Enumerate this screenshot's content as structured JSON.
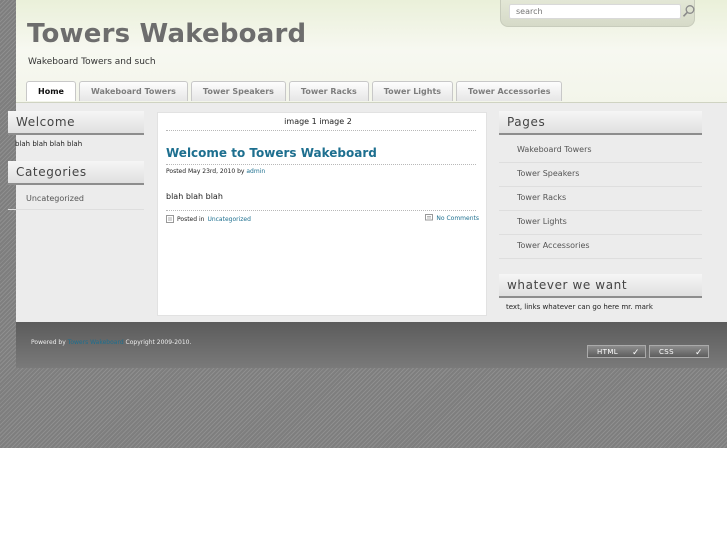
{
  "header": {
    "title": "Towers Wakeboard",
    "description": "Wakeboard Towers and such",
    "search": {
      "placeholder": "search"
    }
  },
  "nav": {
    "tabs": [
      {
        "label": "Home"
      },
      {
        "label": "Wakeboard Towers"
      },
      {
        "label": "Tower Speakers"
      },
      {
        "label": "Tower Racks"
      },
      {
        "label": "Tower Lights"
      },
      {
        "label": "Tower Accessories"
      }
    ]
  },
  "sidebar_left": {
    "welcome": {
      "title": "Welcome",
      "text": "blah blah blah blah"
    },
    "categories": {
      "title": "Categories",
      "items": [
        {
          "label": "Uncategorized"
        }
      ]
    }
  },
  "main": {
    "images_line": "image 1 image 2",
    "post": {
      "title": "Welcome to Towers Wakeboard",
      "meta_prefix": "Posted May 23rd, 2010 by",
      "author": "admin",
      "body": "blah blah blah",
      "posted_in_label": "Posted in",
      "category": "Uncategorized",
      "comments": "No Comments"
    }
  },
  "sidebar_right": {
    "pages": {
      "title": "Pages",
      "items": [
        {
          "label": "Wakeboard Towers"
        },
        {
          "label": "Tower Speakers"
        },
        {
          "label": "Tower Racks"
        },
        {
          "label": "Tower Lights"
        },
        {
          "label": "Tower Accessories"
        }
      ]
    },
    "custom": {
      "title": "whatever we want",
      "text": "text, links whatever can go here mr. mark"
    }
  },
  "footer": {
    "powered_by": "Powered by",
    "site_link": "Towers Wakeboard",
    "copyright": "Copyright 2009-2010.",
    "badges": [
      {
        "label": "HTML"
      },
      {
        "label": "CSS"
      }
    ]
  },
  "colors": {
    "link": "#1d6f8f",
    "title": "#6d6d6d",
    "header_bg": "#eaf0d9"
  }
}
